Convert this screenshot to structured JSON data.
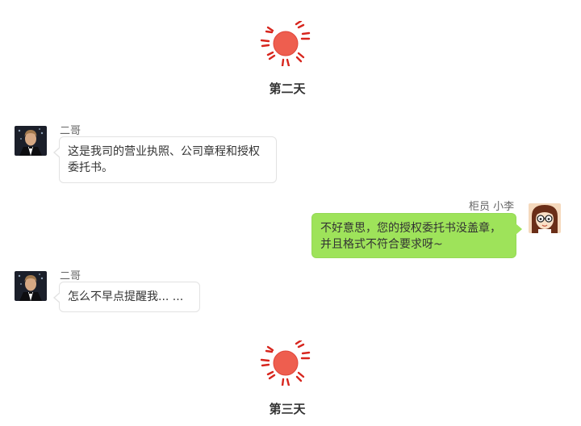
{
  "days": [
    {
      "label": "第二天",
      "icon": "sun-icon"
    },
    {
      "label": "第三天",
      "icon": "sun-icon"
    }
  ],
  "messages": [
    {
      "side": "left",
      "sender": "二哥",
      "avatar": "man-in-tuxedo-avatar",
      "text": "这是我司的营业执照、公司章程和授权委托书。"
    },
    {
      "side": "right",
      "sender": "柜员 小李",
      "avatar": "girl-with-glasses-avatar",
      "text": "不好意思，您的授权委托书没盖章，并且格式不符合要求呀~"
    },
    {
      "side": "left",
      "sender": "二哥",
      "avatar": "man-in-tuxedo-avatar",
      "text": "怎么不早点提醒我... ..."
    }
  ],
  "colors": {
    "sun": "#ee5e4f",
    "sun_rays": "#d7261e",
    "bubble_right": "#9ee35a",
    "bubble_left": "#ffffff",
    "bubble_left_border": "#e2e2e2"
  }
}
